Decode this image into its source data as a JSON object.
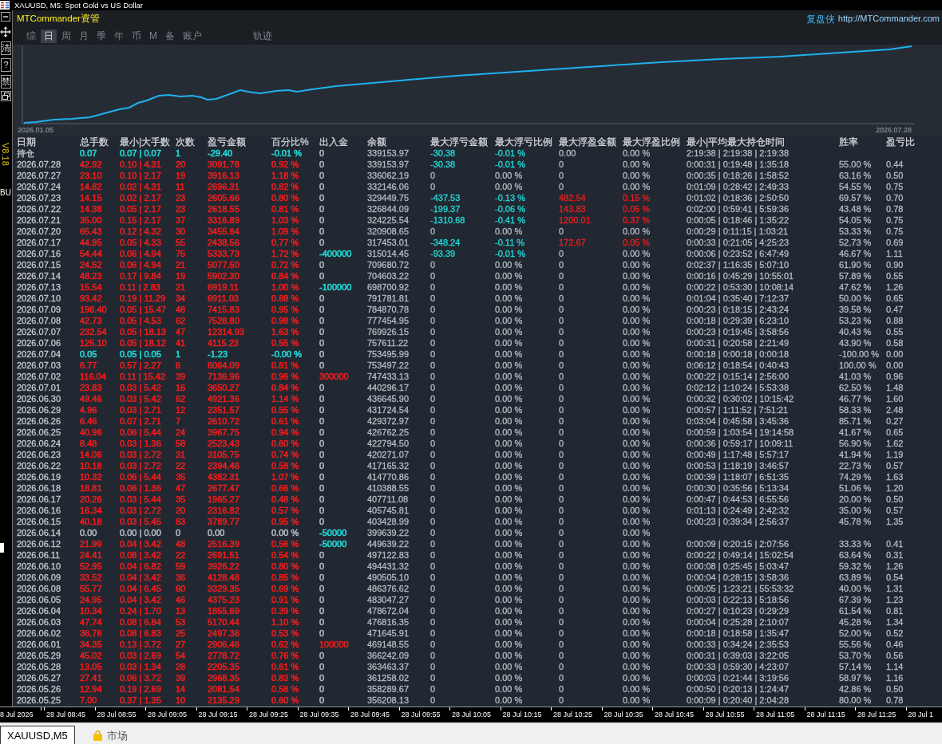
{
  "window": {
    "title": "XAUUSD, M5:  Spot Gold vs US Dollar"
  },
  "side_toolbar": {
    "buttons": [
      "清",
      "?",
      "禁"
    ]
  },
  "chart_overlay": {
    "version": "V8.18",
    "order_label": "BU"
  },
  "panel": {
    "brand": "MTCommander资管",
    "site_name": "复盘侠",
    "site_url": "http://MTCommander.com",
    "tabs": [
      {
        "label": "综",
        "selected": false
      },
      {
        "label": "日",
        "selected": true
      },
      {
        "label": "周",
        "selected": false
      },
      {
        "label": "月",
        "selected": false
      },
      {
        "label": "季",
        "selected": false
      },
      {
        "label": "年",
        "selected": false
      },
      {
        "label": "币",
        "selected": false
      },
      {
        "label": "M",
        "selected": false
      },
      {
        "label": "备",
        "selected": false
      },
      {
        "label": "账户",
        "selected": false
      }
    ],
    "track_tab": {
      "label": "轨迹",
      "selected": false
    },
    "equity_chart": {
      "start_date": "2026.01.05",
      "end_date": "2026.07.28"
    },
    "table": {
      "columns": [
        "日期",
        "总手数",
        "最小|大手数",
        "次数",
        "盈亏金额",
        "百分比%",
        "出入金",
        "余额",
        "最大浮亏金额",
        "最大浮亏比例",
        "最大浮盈金额",
        "最大浮盈比例",
        "最小|平均最大持仓时间",
        "胜率",
        "盈亏比"
      ],
      "rows": [
        {
          "cells": [
            "持仓",
            "0.07",
            "0.07 | 0.07",
            "1",
            "-29.40",
            "-0.01 %",
            {
              "text": "0",
              "color": "#b5bbc3"
            },
            "339153.97",
            "-30.38",
            "-0.01 %",
            "0.00",
            "0.00 %",
            "2:19:38 | 2:19:38 | 2:19:38",
            null,
            null
          ],
          "color": "#20dede",
          "float_loss": true,
          "float_gain": false
        },
        {
          "cells": [
            "2026.07.28",
            "42.92",
            "0.10 | 4.31",
            "20",
            "3091.78",
            "0.92 %",
            {
              "text": "0",
              "color": "#b5bbc3"
            },
            "339153.97",
            "-30.38",
            "-0.01 %",
            "0",
            "0.00 %",
            "0:00:31 | 0:19:48 | 1:35:18",
            "55.00 %",
            "0.44"
          ],
          "color": "#f41c1c",
          "float_loss": true,
          "float_gain": false
        },
        {
          "cells": [
            "2026.07.27",
            "23.10",
            "0.10 | 2.17",
            "19",
            "3916.13",
            "1.18 %",
            {
              "text": "0",
              "color": "#b5bbc3"
            },
            "336062.19",
            "0",
            "0.00 %",
            "0",
            "0.00 %",
            "0:00:35 | 0:18:26 | 1:58:52",
            "63.16 %",
            "0.50"
          ],
          "color": "#f41c1c",
          "float_loss": false,
          "float_gain": false
        },
        {
          "cells": [
            "2026.07.24",
            "14.82",
            "0.02 | 4.31",
            "11",
            "2696.31",
            "0.82 %",
            {
              "text": "0",
              "color": "#b5bbc3"
            },
            "332146.06",
            "0",
            "0.00 %",
            "0",
            "0.00 %",
            "0:01:09 | 0:28:42 | 2:49:33",
            "54.55 %",
            "0.75"
          ],
          "color": "#f41c1c",
          "float_loss": false,
          "float_gain": false
        },
        {
          "cells": [
            "2026.07.23",
            "14.15",
            "0.02 | 2.17",
            "23",
            "2605.66",
            "0.80 %",
            {
              "text": "0",
              "color": "#b5bbc3"
            },
            "329449.75",
            "-437.53",
            "-0.13 %",
            "482.54",
            "0.15 %",
            "0:01:02 | 0:18:36 | 2:50:50",
            "69.57 %",
            "0.70"
          ],
          "color": "#f41c1c",
          "float_loss": true,
          "float_gain": true
        },
        {
          "cells": [
            "2026.07.22",
            "14.38",
            "0.05 | 2.17",
            "23",
            "2618.55",
            "0.81 %",
            {
              "text": "0",
              "color": "#b5bbc3"
            },
            "326844.09",
            "-199.37",
            "-0.06 %",
            "143.83",
            "0.05 %",
            "0:02:00 | 0:59:41 | 5:59:36",
            "43.48 %",
            "0.78"
          ],
          "color": "#f41c1c",
          "float_loss": true,
          "float_gain": true
        },
        {
          "cells": [
            "2026.07.21",
            "35.00",
            "0.15 | 2.17",
            "37",
            "3316.89",
            "1.03 %",
            {
              "text": "0",
              "color": "#b5bbc3"
            },
            "324225.54",
            "-1310.68",
            "-0.41 %",
            "1200.01",
            "0.37 %",
            "0:00:05 | 0:18:46 | 1:35:22",
            "54.05 %",
            "0.75"
          ],
          "color": "#f41c1c",
          "float_loss": true,
          "float_gain": true
        },
        {
          "cells": [
            "2026.07.20",
            "65.43",
            "0.12 | 4.32",
            "30",
            "3455.64",
            "1.09 %",
            {
              "text": "0",
              "color": "#b5bbc3"
            },
            "320908.65",
            "0",
            "0.00 %",
            "0",
            "0.00 %",
            "0:00:29 | 0:11:15 | 1:03:21",
            "53.33 %",
            "0.75"
          ],
          "color": "#f41c1c",
          "float_loss": false,
          "float_gain": false
        },
        {
          "cells": [
            "2026.07.17",
            "44.95",
            "0.05 | 4.33",
            "55",
            "2438.56",
            "0.77 %",
            {
              "text": "0",
              "color": "#b5bbc3"
            },
            "317453.01",
            "-348.24",
            "-0.11 %",
            "172.67",
            "0.05 %",
            "0:00:33 | 0:21:05 | 4:25:23",
            "52.73 %",
            "0.69"
          ],
          "color": "#f41c1c",
          "float_loss": true,
          "float_gain": true
        },
        {
          "cells": [
            "2026.07.16",
            "54.44",
            "0.06 | 4.94",
            "75",
            "5333.73",
            "1.72 %",
            {
              "text": "-400000",
              "color": "#20dede"
            },
            "315014.45",
            "-93.39",
            "-0.01 %",
            "0",
            "0.00 %",
            "0:00:06 | 0:23:52 | 6:47:49",
            "46.67 %",
            "1.11"
          ],
          "color": "#f41c1c",
          "float_loss": true,
          "float_gain": false
        },
        {
          "cells": [
            "2026.07.15",
            "24.52",
            "0.06 | 4.94",
            "21",
            "5077.50",
            "0.72 %",
            {
              "text": "0",
              "color": "#b5bbc3"
            },
            "709680.72",
            "0",
            "0.00 %",
            "0",
            "0.00 %",
            "0:02:37 | 1:16:35 | 5:07:10",
            "61.90 %",
            "0.90"
          ],
          "color": "#f41c1c",
          "float_loss": false,
          "float_gain": false
        },
        {
          "cells": [
            "2026.07.14",
            "48.23",
            "0.17 | 9.84",
            "19",
            "5902.30",
            "0.84 %",
            {
              "text": "0",
              "color": "#b5bbc3"
            },
            "704603.22",
            "0",
            "0.00 %",
            "0",
            "0.00 %",
            "0:00:16 | 0:45:29 | 10:55:01",
            "57.89 %",
            "0.55"
          ],
          "color": "#f41c1c",
          "float_loss": false,
          "float_gain": false
        },
        {
          "cells": [
            "2026.07.13",
            "15.54",
            "0.11 | 2.83",
            "21",
            "6919.11",
            "1.00 %",
            {
              "text": "-100000",
              "color": "#20dede"
            },
            "698700.92",
            "0",
            "0.00 %",
            "0",
            "0.00 %",
            "0:00:22 | 0:53:30 | 10:08:14",
            "47.62 %",
            "1.26"
          ],
          "color": "#f41c1c",
          "float_loss": false,
          "float_gain": false
        },
        {
          "cells": [
            "2026.07.10",
            "93.42",
            "0.19 | 11.29",
            "34",
            "6911.03",
            "0.88 %",
            {
              "text": "0",
              "color": "#b5bbc3"
            },
            "791781.81",
            "0",
            "0.00 %",
            "0",
            "0.00 %",
            "0:01:04 | 0:35:40 | 7:12:37",
            "50.00 %",
            "0.65"
          ],
          "color": "#f41c1c",
          "float_loss": false,
          "float_gain": false
        },
        {
          "cells": [
            "2026.07.09",
            "196.40",
            "0.05 | 15.47",
            "48",
            "7415.83",
            "0.95 %",
            {
              "text": "0",
              "color": "#b5bbc3"
            },
            "784870.78",
            "0",
            "0.00 %",
            "0",
            "0.00 %",
            "0:00:23 | 0:18:15 | 2:43:24",
            "39.58 %",
            "0.47"
          ],
          "color": "#f41c1c",
          "float_loss": false,
          "float_gain": false
        },
        {
          "cells": [
            "2026.07.08",
            "42.73",
            "0.05 | 4.53",
            "62",
            "7528.80",
            "0.98 %",
            {
              "text": "0",
              "color": "#b5bbc3"
            },
            "777454.95",
            "0",
            "0.00 %",
            "0",
            "0.00 %",
            "0:00:18 | 0:29:39 | 6:23:10",
            "53.23 %",
            "0.88"
          ],
          "color": "#f41c1c",
          "float_loss": false,
          "float_gain": false
        },
        {
          "cells": [
            "2026.07.07",
            "232.54",
            "0.05 | 18.13",
            "47",
            "12314.93",
            "1.63 %",
            {
              "text": "0",
              "color": "#b5bbc3"
            },
            "769926.15",
            "0",
            "0.00 %",
            "0",
            "0.00 %",
            "0:00:23 | 0:19:45 | 3:58:56",
            "40.43 %",
            "0.55"
          ],
          "color": "#f41c1c",
          "float_loss": false,
          "float_gain": false
        },
        {
          "cells": [
            "2026.07.06",
            "125.10",
            "0.05 | 18.12",
            "41",
            "4115.23",
            "0.55 %",
            {
              "text": "0",
              "color": "#b5bbc3"
            },
            "757611.22",
            "0",
            "0.00 %",
            "0",
            "0.00 %",
            "0:00:31 | 0:20:58 | 2:21:49",
            "43.90 %",
            "0.58"
          ],
          "color": "#f41c1c",
          "float_loss": false,
          "float_gain": false
        },
        {
          "cells": [
            "2026.07.04",
            "0.05",
            "0.05 | 0.05",
            "1",
            "-1.23",
            "-0.00 %",
            {
              "text": "0",
              "color": "#b5bbc3"
            },
            "753495.99",
            "0",
            "0.00 %",
            "0",
            "0.00 %",
            "0:00:18 | 0:00:18 | 0:00:18",
            "-100.00 %",
            "0.00"
          ],
          "color": "#20dede",
          "float_loss": false,
          "float_gain": false
        },
        {
          "cells": [
            "2026.07.03",
            "6.77",
            "0.57 | 2.27",
            "6",
            "6064.09",
            "0.81 %",
            {
              "text": "0",
              "color": "#b5bbc3"
            },
            "753497.22",
            "0",
            "0.00 %",
            "0",
            "0.00 %",
            "0:06:12 | 0:18:54 | 0:40:43",
            "100.00 %",
            "0.00"
          ],
          "color": "#f41c1c",
          "float_loss": false,
          "float_gain": false
        },
        {
          "cells": [
            "2026.07.02",
            "116.04",
            "0.11 | 15.42",
            "39",
            "7136.96",
            "0.96 %",
            {
              "text": "300000",
              "color": "#f41c1c"
            },
            "747433.13",
            "0",
            "0.00 %",
            "0",
            "0.00 %",
            "0:00:22 | 0:15:14 | 2:56:00",
            "41.03 %",
            "0.96"
          ],
          "color": "#f41c1c",
          "float_loss": false,
          "float_gain": false
        },
        {
          "cells": [
            "2026.07.01",
            "23.83",
            "0.03 | 5.42",
            "16",
            "3650.27",
            "0.84 %",
            {
              "text": "0",
              "color": "#b5bbc3"
            },
            "440296.17",
            "0",
            "0.00 %",
            "0",
            "0.00 %",
            "0:02:12 | 1:10:24 | 5:53:38",
            "62.50 %",
            "1.48"
          ],
          "color": "#f41c1c",
          "float_loss": false,
          "float_gain": false
        },
        {
          "cells": [
            "2026.06.30",
            "49.46",
            "0.03 | 5.42",
            "62",
            "4921.36",
            "1.14 %",
            {
              "text": "0",
              "color": "#b5bbc3"
            },
            "436645.90",
            "0",
            "0.00 %",
            "0",
            "0.00 %",
            "0:00:32 | 0:30:02 | 10:15:42",
            "46.77 %",
            "1.60"
          ],
          "color": "#f41c1c",
          "float_loss": false,
          "float_gain": false
        },
        {
          "cells": [
            "2026.06.29",
            "4.96",
            "0.03 | 2.71",
            "12",
            "2351.57",
            "0.55 %",
            {
              "text": "0",
              "color": "#b5bbc3"
            },
            "431724.54",
            "0",
            "0.00 %",
            "0",
            "0.00 %",
            "0:00:57 | 1:11:52 | 7:51:21",
            "58.33 %",
            "2.48"
          ],
          "color": "#f41c1c",
          "float_loss": false,
          "float_gain": false
        },
        {
          "cells": [
            "2026.06.26",
            "6.46",
            "0.07 | 2.71",
            "7",
            "2610.72",
            "0.61 %",
            {
              "text": "0",
              "color": "#b5bbc3"
            },
            "429372.97",
            "0",
            "0.00 %",
            "0",
            "0.00 %",
            "0:03:04 | 0:45:58 | 3:45:36",
            "85.71 %",
            "0.27"
          ],
          "color": "#f41c1c",
          "float_loss": false,
          "float_gain": false
        },
        {
          "cells": [
            "2026.06.25",
            "40.96",
            "0.06 | 5.44",
            "24",
            "3967.75",
            "0.94 %",
            {
              "text": "0",
              "color": "#b5bbc3"
            },
            "426762.25",
            "0",
            "0.00 %",
            "0",
            "0.00 %",
            "0:00:59 | 1:03:54 | 19:14:58",
            "41.67 %",
            "0.65"
          ],
          "color": "#f41c1c",
          "float_loss": false,
          "float_gain": false
        },
        {
          "cells": [
            "2026.06.24",
            "8.48",
            "0.03 | 1.36",
            "58",
            "2523.43",
            "0.60 %",
            {
              "text": "0",
              "color": "#b5bbc3"
            },
            "422794.50",
            "0",
            "0.00 %",
            "0",
            "0.00 %",
            "0:00:36 | 0:59:17 | 10:09:11",
            "56.90 %",
            "1.62"
          ],
          "color": "#f41c1c",
          "float_loss": false,
          "float_gain": false
        },
        {
          "cells": [
            "2026.06.23",
            "14.06",
            "0.03 | 2.72",
            "31",
            "3105.75",
            "0.74 %",
            {
              "text": "0",
              "color": "#b5bbc3"
            },
            "420271.07",
            "0",
            "0.00 %",
            "0",
            "0.00 %",
            "0:00:49 | 1:17:48 | 5:57:17",
            "41.94 %",
            "1.19"
          ],
          "color": "#f41c1c",
          "float_loss": false,
          "float_gain": false
        },
        {
          "cells": [
            "2026.06.22",
            "10.18",
            "0.03 | 2.72",
            "22",
            "2394.46",
            "0.58 %",
            {
              "text": "0",
              "color": "#b5bbc3"
            },
            "417165.32",
            "0",
            "0.00 %",
            "0",
            "0.00 %",
            "0:00:53 | 1:18:19 | 3:46:57",
            "22.73 %",
            "0.57"
          ],
          "color": "#f41c1c",
          "float_loss": false,
          "float_gain": false
        },
        {
          "cells": [
            "2026.06.19",
            "10.32",
            "0.06 | 5.44",
            "35",
            "4382.31",
            "1.07 %",
            {
              "text": "0",
              "color": "#b5bbc3"
            },
            "414770.86",
            "0",
            "0.00 %",
            "0",
            "0.00 %",
            "0:00:39 | 1:18:07 | 6:51:35",
            "74.29 %",
            "1.63"
          ],
          "color": "#f41c1c",
          "float_loss": false,
          "float_gain": false
        },
        {
          "cells": [
            "2026.06.18",
            "18.81",
            "0.06 | 1.36",
            "47",
            "2677.47",
            "0.66 %",
            {
              "text": "0",
              "color": "#b5bbc3"
            },
            "410388.55",
            "0",
            "0.00 %",
            "0",
            "0.00 %",
            "0:00:30 | 0:35:56 | 5:13:34",
            "51.06 %",
            "1.20"
          ],
          "color": "#f41c1c",
          "float_loss": false,
          "float_gain": false
        },
        {
          "cells": [
            "2026.06.17",
            "20.26",
            "0.03 | 5.44",
            "35",
            "1965.27",
            "0.48 %",
            {
              "text": "0",
              "color": "#b5bbc3"
            },
            "407711.08",
            "0",
            "0.00 %",
            "0",
            "0.00 %",
            "0:00:47 | 0:44:53 | 6:55:56",
            "20.00 %",
            "0.50"
          ],
          "color": "#f41c1c",
          "float_loss": false,
          "float_gain": false
        },
        {
          "cells": [
            "2026.06.16",
            "16.34",
            "0.03 | 2.72",
            "20",
            "2316.82",
            "0.57 %",
            {
              "text": "0",
              "color": "#b5bbc3"
            },
            "405745.81",
            "0",
            "0.00 %",
            "0",
            "0.00 %",
            "0:01:13 | 0:24:49 | 2:42:32",
            "35.00 %",
            "0.57"
          ],
          "color": "#f41c1c",
          "float_loss": false,
          "float_gain": false
        },
        {
          "cells": [
            "2026.06.15",
            "40.18",
            "0.03 | 5.45",
            "83",
            "3789.77",
            "0.95 %",
            {
              "text": "0",
              "color": "#b5bbc3"
            },
            "403428.99",
            "0",
            "0.00 %",
            "0",
            "0.00 %",
            "0:00:23 | 0:39:34 | 2:56:37",
            "45.78 %",
            "1.35"
          ],
          "color": "#f41c1c",
          "float_loss": false,
          "float_gain": false
        },
        {
          "cells": [
            "2026.06.14",
            "0.00",
            "0.00 | 0.00",
            "0",
            "0.00",
            "0.00 %",
            {
              "text": "-50000",
              "color": "#20dede"
            },
            "399639.22",
            "0",
            "0.00 %",
            "0",
            "0.00 %",
            null,
            null,
            null
          ],
          "color": "#b5bbc3",
          "float_loss": false,
          "float_gain": false
        },
        {
          "cells": [
            "2026.06.12",
            "21.99",
            "0.04 | 3.42",
            "48",
            "2516.39",
            "0.56 %",
            {
              "text": "-50000",
              "color": "#20dede"
            },
            "449639.22",
            "0",
            "0.00 %",
            "0",
            "0.00 %",
            "0:00:09 | 0:20:15 | 2:07:56",
            "33.33 %",
            "0.41"
          ],
          "color": "#f41c1c",
          "float_loss": false,
          "float_gain": false
        },
        {
          "cells": [
            "2026.06.11",
            "24.41",
            "0.08 | 3.42",
            "22",
            "2691.51",
            "0.54 %",
            {
              "text": "0",
              "color": "#b5bbc3"
            },
            "497122.83",
            "0",
            "0.00 %",
            "0",
            "0.00 %",
            "0:00:22 | 0:49:14 | 15:02:54",
            "63.64 %",
            "0.31"
          ],
          "color": "#f41c1c",
          "float_loss": false,
          "float_gain": false
        },
        {
          "cells": [
            "2026.06.10",
            "52.95",
            "0.04 | 6.82",
            "59",
            "3926.22",
            "0.80 %",
            {
              "text": "0",
              "color": "#b5bbc3"
            },
            "494431.32",
            "0",
            "0.00 %",
            "0",
            "0.00 %",
            "0:00:08 | 0:25:45 | 5:03:47",
            "59.32 %",
            "1.26"
          ],
          "color": "#f41c1c",
          "float_loss": false,
          "float_gain": false
        },
        {
          "cells": [
            "2026.06.09",
            "33.52",
            "0.04 | 3.42",
            "36",
            "4128.48",
            "0.85 %",
            {
              "text": "0",
              "color": "#b5bbc3"
            },
            "490505.10",
            "0",
            "0.00 %",
            "0",
            "0.00 %",
            "0:00:04 | 0:28:15 | 3:58:36",
            "63.89 %",
            "0.54"
          ],
          "color": "#f41c1c",
          "float_loss": false,
          "float_gain": false
        },
        {
          "cells": [
            "2026.06.08",
            "55.77",
            "0.04 | 6.45",
            "60",
            "3329.35",
            "0.69 %",
            {
              "text": "0",
              "color": "#b5bbc3"
            },
            "486376.62",
            "0",
            "0.00 %",
            "0",
            "0.00 %",
            "0:00:05 | 1:23:21 | 55:53:32",
            "40.00 %",
            "1.31"
          ],
          "color": "#f41c1c",
          "float_loss": false,
          "float_gain": false
        },
        {
          "cells": [
            "2026.06.05",
            "24.95",
            "0.04 | 3.42",
            "46",
            "4375.23",
            "0.91 %",
            {
              "text": "0",
              "color": "#b5bbc3"
            },
            "483047.27",
            "0",
            "0.00 %",
            "0",
            "0.00 %",
            "0:00:03 | 0:22:13 | 5:18:56",
            "67.39 %",
            "1.23"
          ],
          "color": "#f41c1c",
          "float_loss": false,
          "float_gain": false
        },
        {
          "cells": [
            "2026.06.04",
            "10.34",
            "0.24 | 1.70",
            "13",
            "1855.69",
            "0.39 %",
            {
              "text": "0",
              "color": "#b5bbc3"
            },
            "478672.04",
            "0",
            "0.00 %",
            "0",
            "0.00 %",
            "0:00:27 | 0:10:23 | 0:29:29",
            "61.54 %",
            "0.81"
          ],
          "color": "#f41c1c",
          "float_loss": false,
          "float_gain": false
        },
        {
          "cells": [
            "2026.06.03",
            "47.74",
            "0.08 | 6.84",
            "53",
            "5170.44",
            "1.10 %",
            {
              "text": "0",
              "color": "#b5bbc3"
            },
            "476816.35",
            "0",
            "0.00 %",
            "0",
            "0.00 %",
            "0:00:04 | 0:25:28 | 2:10:07",
            "45.28 %",
            "1.34"
          ],
          "color": "#f41c1c",
          "float_loss": false,
          "float_gain": false
        },
        {
          "cells": [
            "2026.06.02",
            "36.76",
            "0.08 | 6.83",
            "25",
            "2497.36",
            "0.53 %",
            {
              "text": "0",
              "color": "#b5bbc3"
            },
            "471645.91",
            "0",
            "0.00 %",
            "0",
            "0.00 %",
            "0:00:18 | 0:18:58 | 1:35:47",
            "52.00 %",
            "0.52"
          ],
          "color": "#f41c1c",
          "float_loss": false,
          "float_gain": false
        },
        {
          "cells": [
            "2026.06.01",
            "34.35",
            "0.13 | 3.72",
            "27",
            "2906.46",
            "0.62 %",
            {
              "text": "100000",
              "color": "#f41c1c"
            },
            "469148.55",
            "0",
            "0.00 %",
            "0",
            "0.00 %",
            "0:00:33 | 0:34:24 | 2:35:53",
            "55.56 %",
            "0.46"
          ],
          "color": "#f41c1c",
          "float_loss": false,
          "float_gain": false
        },
        {
          "cells": [
            "2026.05.29",
            "45.02",
            "0.03 | 2.69",
            "54",
            "2778.72",
            "0.76 %",
            {
              "text": "0",
              "color": "#b5bbc3"
            },
            "366242.09",
            "0",
            "0.00 %",
            "0",
            "0.00 %",
            "0:00:31 | 0:39:03 | 3:22:05",
            "53.70 %",
            "0.56"
          ],
          "color": "#f41c1c",
          "float_loss": false,
          "float_gain": false
        },
        {
          "cells": [
            "2026.05.28",
            "13.05",
            "0.03 | 1.34",
            "28",
            "2205.35",
            "0.61 %",
            {
              "text": "0",
              "color": "#b5bbc3"
            },
            "363463.37",
            "0",
            "0.00 %",
            "0",
            "0.00 %",
            "0:00:33 | 0:59:30 | 4:23:07",
            "57.14 %",
            "1.14"
          ],
          "color": "#f41c1c",
          "float_loss": false,
          "float_gain": false
        },
        {
          "cells": [
            "2026.05.27",
            "27.41",
            "0.06 | 3.72",
            "39",
            "2968.35",
            "0.83 %",
            {
              "text": "0",
              "color": "#b5bbc3"
            },
            "361258.02",
            "0",
            "0.00 %",
            "0",
            "0.00 %",
            "0:00:03 | 0:21:44 | 3:19:56",
            "58.97 %",
            "1.16"
          ],
          "color": "#f41c1c",
          "float_loss": false,
          "float_gain": false
        },
        {
          "cells": [
            "2026.05.26",
            "12.94",
            "0.19 | 2.69",
            "14",
            "2081.54",
            "0.58 %",
            {
              "text": "0",
              "color": "#b5bbc3"
            },
            "358289.67",
            "0",
            "0.00 %",
            "0",
            "0.00 %",
            "0:00:50 | 0:20:13 | 1:24:47",
            "42.86 %",
            "0.50"
          ],
          "color": "#f41c1c",
          "float_loss": false,
          "float_gain": false
        },
        {
          "cells": [
            "2026.05.25",
            "7.00",
            "0.37 | 1.35",
            "10",
            "2135.29",
            "0.60 %",
            {
              "text": "0",
              "color": "#b5bbc3"
            },
            "356208.13",
            "0",
            "0.00 %",
            "0",
            "0.00 %",
            "0:00:09 | 0:20:40 | 2:04:28",
            "80.00 %",
            "0.78"
          ],
          "color": "#f41c1c",
          "float_loss": false,
          "float_gain": false
        }
      ]
    }
  },
  "time_axis": {
    "labels": [
      "8 Jul 2026",
      "28 Jul 08:45",
      "28 Jul 08:55",
      "28 Jul 09:05",
      "28 Jul 09:15",
      "28 Jul 09:25",
      "28 Jul 09:35",
      "28 Jul 09:45",
      "28 Jul 09:55",
      "28 Jul 10:05",
      "28 Jul 10:15",
      "28 Jul 10:25",
      "28 Jul 10:35",
      "28 Jul 10:45",
      "28 Jul 10:55",
      "28 Jul 11:05",
      "28 Jul 11:15",
      "28 Jul 11:25",
      "28 Jul 1"
    ]
  },
  "bottom_tabs": [
    {
      "label": "XAUUSD,M5",
      "kind": "chart",
      "selected": true
    },
    {
      "label": "市场",
      "kind": "market",
      "selected": false
    }
  ]
}
